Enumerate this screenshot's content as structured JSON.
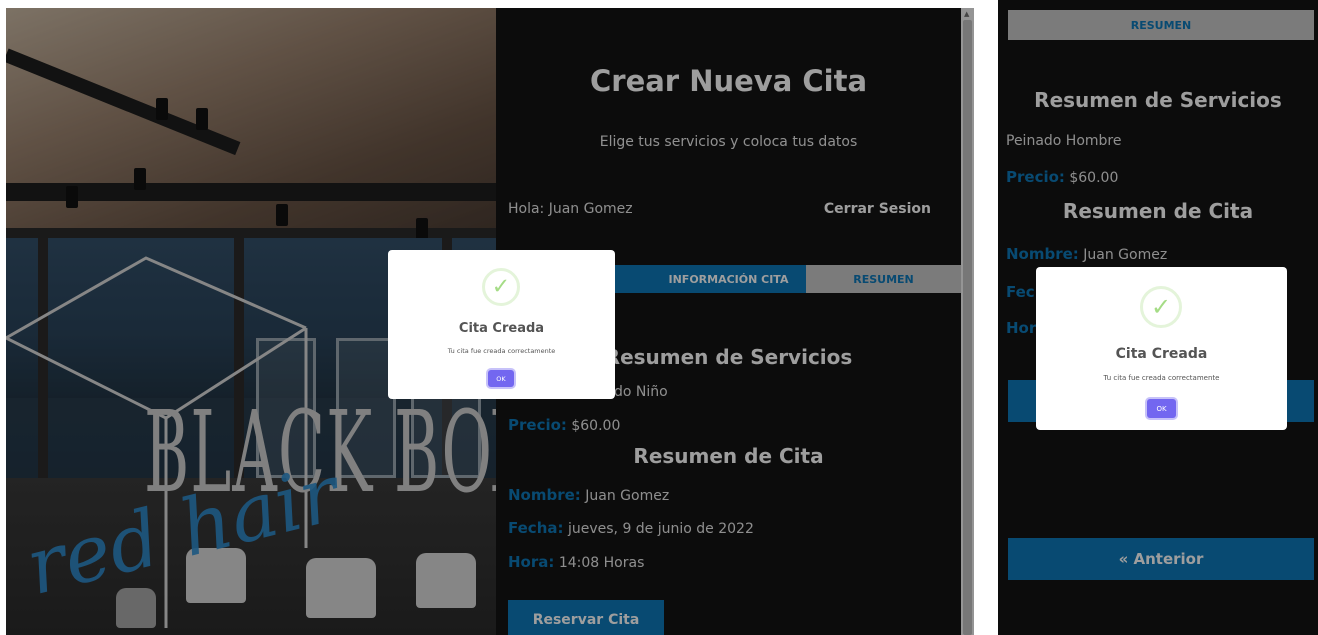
{
  "left": {
    "hero": {
      "logo_text": "BLACK BOX",
      "script_text": "red hair"
    },
    "panel": {
      "title": "Crear Nueva Cita",
      "subtitle": "Elige tus servicios y coloca tus datos",
      "greeting": "Hola: Juan Gomez",
      "logout": "Cerrar Sesion",
      "tabs": [
        "",
        "INFORMACIÓN CITA",
        "RESUMEN"
      ],
      "services_heading": "Resumen de Servicios",
      "service_name_visible": "do Niño",
      "price_label": "Precio:",
      "price_value": "$60.00",
      "appointment_heading": "Resumen de Cita",
      "name_label": "Nombre:",
      "name_value": "Juan Gomez",
      "date_label": "Fecha:",
      "date_value": "jueves, 9 de junio de 2022",
      "time_label": "Hora:",
      "time_value": "14:08 Horas",
      "reserve_button": "Reservar Cita"
    },
    "modal": {
      "title": "Cita Creada",
      "text": "Tu cita fue creada correctamente",
      "ok": "OK"
    }
  },
  "right": {
    "tab": "RESUMEN",
    "services_heading": "Resumen de Servicios",
    "service_name": "Peinado Hombre",
    "price_label": "Precio:",
    "price_value": "$60.00",
    "appointment_heading": "Resumen de Cita",
    "name_label": "Nombre:",
    "name_value": "Juan Gomez",
    "date_label_partial": "Fec",
    "time_label_partial": "Hor",
    "prev_button": "« Anterior",
    "modal": {
      "title": "Cita Creada",
      "text": "Tu cita fue creada correctamente",
      "ok": "OK"
    }
  },
  "colors": {
    "accent": "#0d78b8",
    "panel_bg": "#141414",
    "ok_button": "#7367f0",
    "success": "#a5dc86"
  }
}
